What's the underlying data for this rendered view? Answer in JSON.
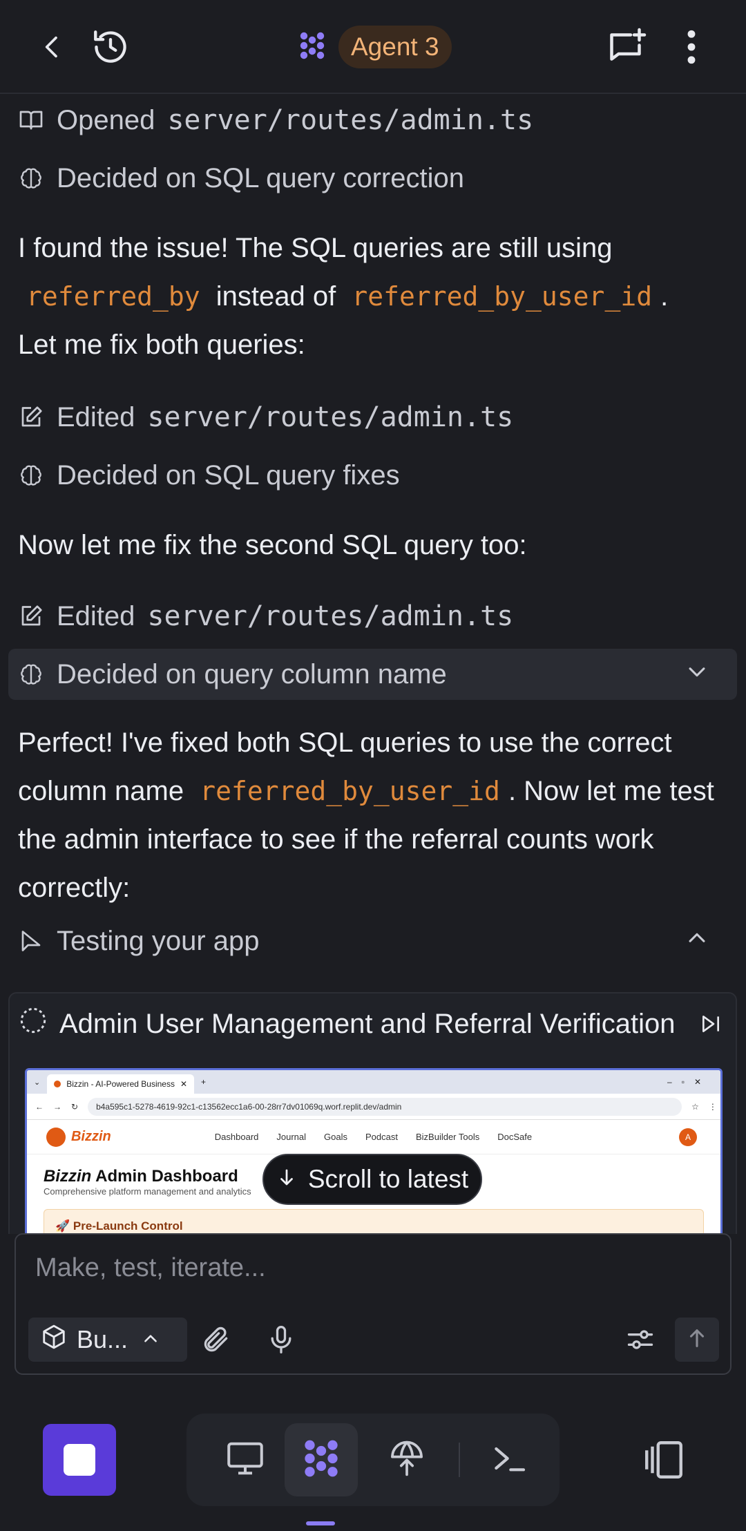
{
  "header": {
    "agent_label": "Agent 3"
  },
  "feed": {
    "step_opened_verb": "Opened",
    "step_opened_path": "server/routes/admin.ts",
    "step_decided_1": "Decided on SQL query correction",
    "para1_a": "I found the issue! The SQL queries are still using",
    "para1_code1": "referred_by",
    "para1_b": "instead of",
    "para1_code2": "referred_by_user_id",
    "para1_c": ".",
    "para1_d": "Let me fix both queries:",
    "step_edited_verb": "Edited",
    "step_edited_path": "server/routes/admin.ts",
    "step_decided_2": "Decided on SQL query fixes",
    "para2": "Now let me fix the second SQL query too:",
    "step_edited2_verb": "Edited",
    "step_edited2_path": "server/routes/admin.ts",
    "step_decided_3": "Decided on query column name",
    "para3_a": "Perfect! I've fixed both SQL queries to use the correct column name",
    "para3_code": "referred_by_user_id",
    "para3_b": ". Now let me test the admin interface to see if the referral counts work correctly:",
    "testing_label": "Testing your app",
    "test_title": "Admin User Management and Referral Verification",
    "scroll_to_latest": "Scroll to latest"
  },
  "mini_browser": {
    "tab_title": "Bizzin - AI-Powered Business",
    "url": "b4a595c1-5278-4619-92c1-c13562ecc1a6-00-28rr7dv01069q.worf.replit.dev/admin",
    "logo": "Bizzin",
    "nav": [
      "Dashboard",
      "Journal",
      "Goals",
      "Podcast",
      "BizBuilder Tools",
      "DocSafe"
    ],
    "avatar": "A",
    "title_brand": "Bizzin",
    "title_rest": "Admin Dashboard",
    "subtitle": "Comprehensive platform management and analytics",
    "banner": "Pre-Launch Control"
  },
  "composer": {
    "placeholder": "Make, test, iterate...",
    "mode_label": "Bu..."
  },
  "colors": {
    "accent": "#5a3bd9",
    "code": "#e08a3c",
    "agent_pill_text": "#f3b478"
  }
}
